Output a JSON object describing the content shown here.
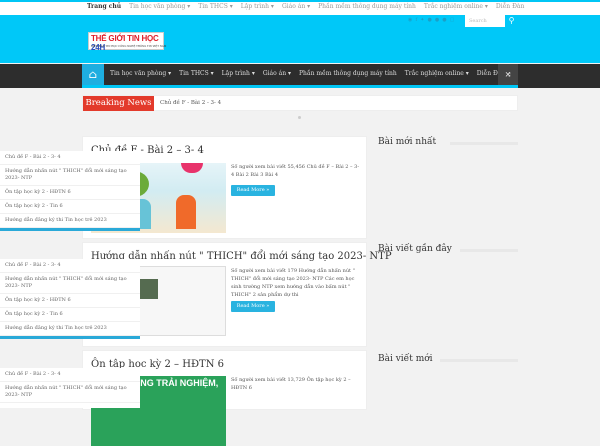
{
  "top_menu": [
    "Trang chủ",
    "Tin học văn phòng ▾",
    "Tin THCS ▾",
    "Lập trình ▾",
    "Giáo án ▾",
    "Phần mềm thông dụng máy tính",
    "Trắc nghiệm online ▾",
    "Diễn Đàn"
  ],
  "logo": {
    "title": "THẾ GIỚI TIN HỌC",
    "num": "24H",
    "subtitle": "DIỄN ĐÀN TIN HỌC CÔNG NGHỆ THÔNG TIN VIỆT NAM"
  },
  "search": {
    "placeholder": "Search"
  },
  "nav": [
    "Tin học văn phòng ▾",
    "Tin THCS ▾",
    "Lập trình ▾",
    "Giáo án ▾",
    "Phần mềm thông dụng máy tính",
    "Trắc nghiệm online ▾",
    "Diễn Đàn"
  ],
  "breaking": {
    "label": "Breaking News",
    "text": "Chủ đề F - Bài 2 - 3- 4"
  },
  "posts": [
    {
      "title": "Chủ đề F - Bài 2 – 3- 4",
      "excerpt": "Số người xem bài viết 55,456 Chủ đề F – Bài 2 – 3- 4 Bài 2 Bài 3 Bài 4",
      "more": "Read More »"
    },
    {
      "title": "Hướng dẫn nhấn nút \" THICH\" đổi mới sáng tạo 2023- NTP",
      "excerpt": "Số người xem bài viết 179 Hướng dẫn nhấn nút \" THICH\" đổi mới sáng tạo 2023- NTP Các em học sinh trường NTP xem hướng dẫn vào bấm nút \" THICH\" 2 sản phẩm dự thi",
      "more": "Read More »"
    },
    {
      "title": "Ôn tập học kỳ 2 – HĐTN 6",
      "excerpt": "Số người xem bài viết 13,729 Ôn tập học kỳ 2 – HĐTN 6",
      "more": "Read More »",
      "image_text": "HOẠT ĐỘNG TRẢI NGHIỆM,"
    }
  ],
  "widgets": [
    {
      "title": "Bài mới nhất",
      "items": [
        "Chủ đề F - Bài 2 - 3- 4",
        "Hướng dẫn nhấn nút \" THICH\" đổi mới sáng tạo 2023- NTP",
        "Ôn tập học kỳ 2 - HĐTN 6",
        "Ôn tập học kỳ 2 - Tin 6",
        "Hướng dẫn đăng ký thi Tin học trẻ 2023"
      ]
    },
    {
      "title": "Bài viết gần đây",
      "items": [
        "Chủ đề F - Bài 2 - 3- 4",
        "Hướng dẫn nhấn nút \" THICH\" đổi mới sáng tạo 2023- NTP",
        "Ôn tập học kỳ 2 - HĐTN 6",
        "Ôn tập học kỳ 2 - Tin 6",
        "Hướng dẫn đăng ký thi Tin học trẻ 2023"
      ]
    },
    {
      "title": "Bài viết mới",
      "items": [
        "Chủ đề F - Bài 2 - 3- 4",
        "Hướng dẫn nhấn nút \" THICH\" đổi mới sáng tạo 2023- NTP"
      ]
    }
  ]
}
